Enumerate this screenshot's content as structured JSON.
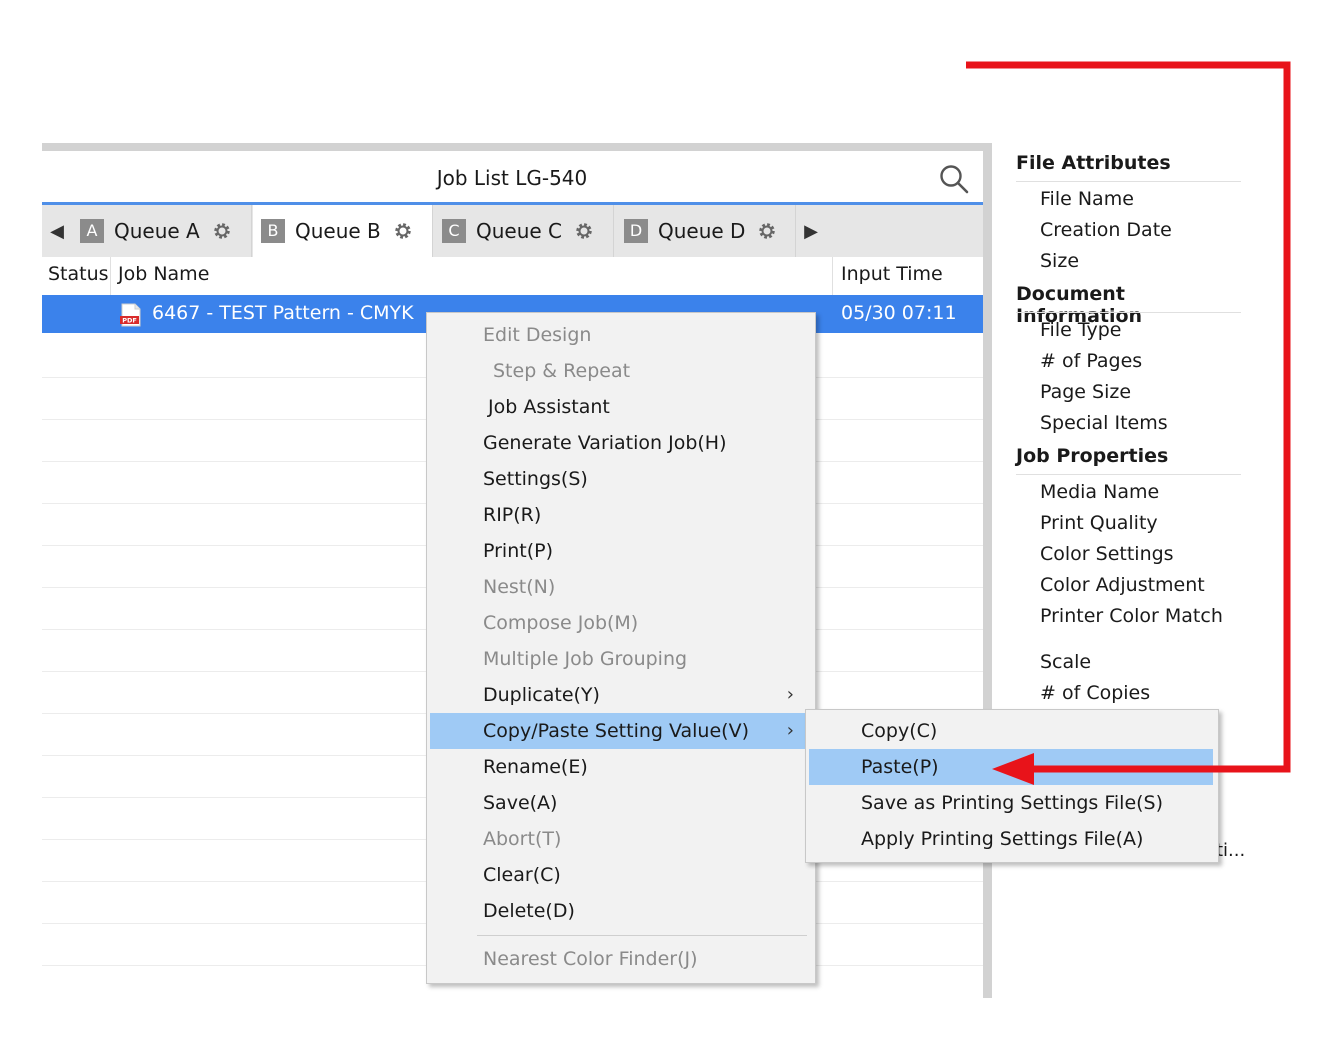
{
  "window": {
    "title": "Job List LG-540"
  },
  "tabs": [
    {
      "badge": "A",
      "label": "Queue A",
      "active": false
    },
    {
      "badge": "B",
      "label": "Queue B",
      "active": true
    },
    {
      "badge": "C",
      "label": "Queue C",
      "active": false
    },
    {
      "badge": "D",
      "label": "Queue D",
      "active": false
    }
  ],
  "columns": {
    "status": "Status",
    "job_name": "Job Name",
    "input_time": "Input Time"
  },
  "job": {
    "name": "6467 - TEST Pattern - CMYK",
    "input_time": "05/30 07:11"
  },
  "attributes": {
    "file_attributes": {
      "heading": "File Attributes",
      "items": [
        "File Name",
        "Creation Date",
        "Size"
      ]
    },
    "document_information": {
      "heading": "Document Information",
      "items": [
        "File Type",
        "# of Pages",
        "Page Size",
        "Special Items"
      ]
    },
    "job_properties": {
      "heading": "Job Properties",
      "items": [
        "Media Name",
        "Print Quality",
        "Color Settings",
        "Color Adjustment",
        "Printer Color Match",
        "Scale",
        "# of Copies"
      ]
    },
    "truncated": "ti..."
  },
  "context_menu": {
    "items": [
      {
        "label": "Edit Design",
        "disabled": true
      },
      {
        "label": "Step & Repeat",
        "disabled": true
      },
      {
        "label": "Job Assistant",
        "disabled": false
      },
      {
        "label": "Generate Variation Job(H)",
        "disabled": false
      },
      {
        "label": "Settings(S)",
        "disabled": false
      },
      {
        "label": "RIP(R)",
        "disabled": false
      },
      {
        "label": "Print(P)",
        "disabled": false
      },
      {
        "label": "Nest(N)",
        "disabled": true
      },
      {
        "label": "Compose Job(M)",
        "disabled": true
      },
      {
        "label": "Multiple Job Grouping",
        "disabled": true
      },
      {
        "label": "Duplicate(Y)",
        "disabled": false,
        "submenu": true
      },
      {
        "label": "Copy/Paste Setting Value(V)",
        "disabled": false,
        "submenu": true,
        "highlighted": true
      },
      {
        "label": "Rename(E)",
        "disabled": false
      },
      {
        "label": "Save(A)",
        "disabled": false
      },
      {
        "label": "Abort(T)",
        "disabled": true
      },
      {
        "label": "Clear(C)",
        "disabled": false
      },
      {
        "label": "Delete(D)",
        "disabled": false
      },
      {
        "label": "Nearest Color Finder(J)",
        "disabled": true
      }
    ]
  },
  "submenu": {
    "items": [
      {
        "label": "Copy(C)"
      },
      {
        "label": "Paste(P)",
        "highlighted": true
      },
      {
        "label": "Save as Printing Settings File(S)"
      },
      {
        "label": "Apply Printing Settings File(A)"
      }
    ]
  },
  "colors": {
    "selection": "#3b82eb",
    "menu_highlight": "#9fcaf5",
    "annotation": "#e8131a",
    "title_underline": "#4f8fe8"
  },
  "icons": {
    "search": "search-icon",
    "gear": "gear-icon",
    "pdf": "pdf-file-icon",
    "tab_prev": "triangle-left-icon",
    "tab_next": "triangle-right-icon",
    "submenu": "chevron-right-icon"
  }
}
